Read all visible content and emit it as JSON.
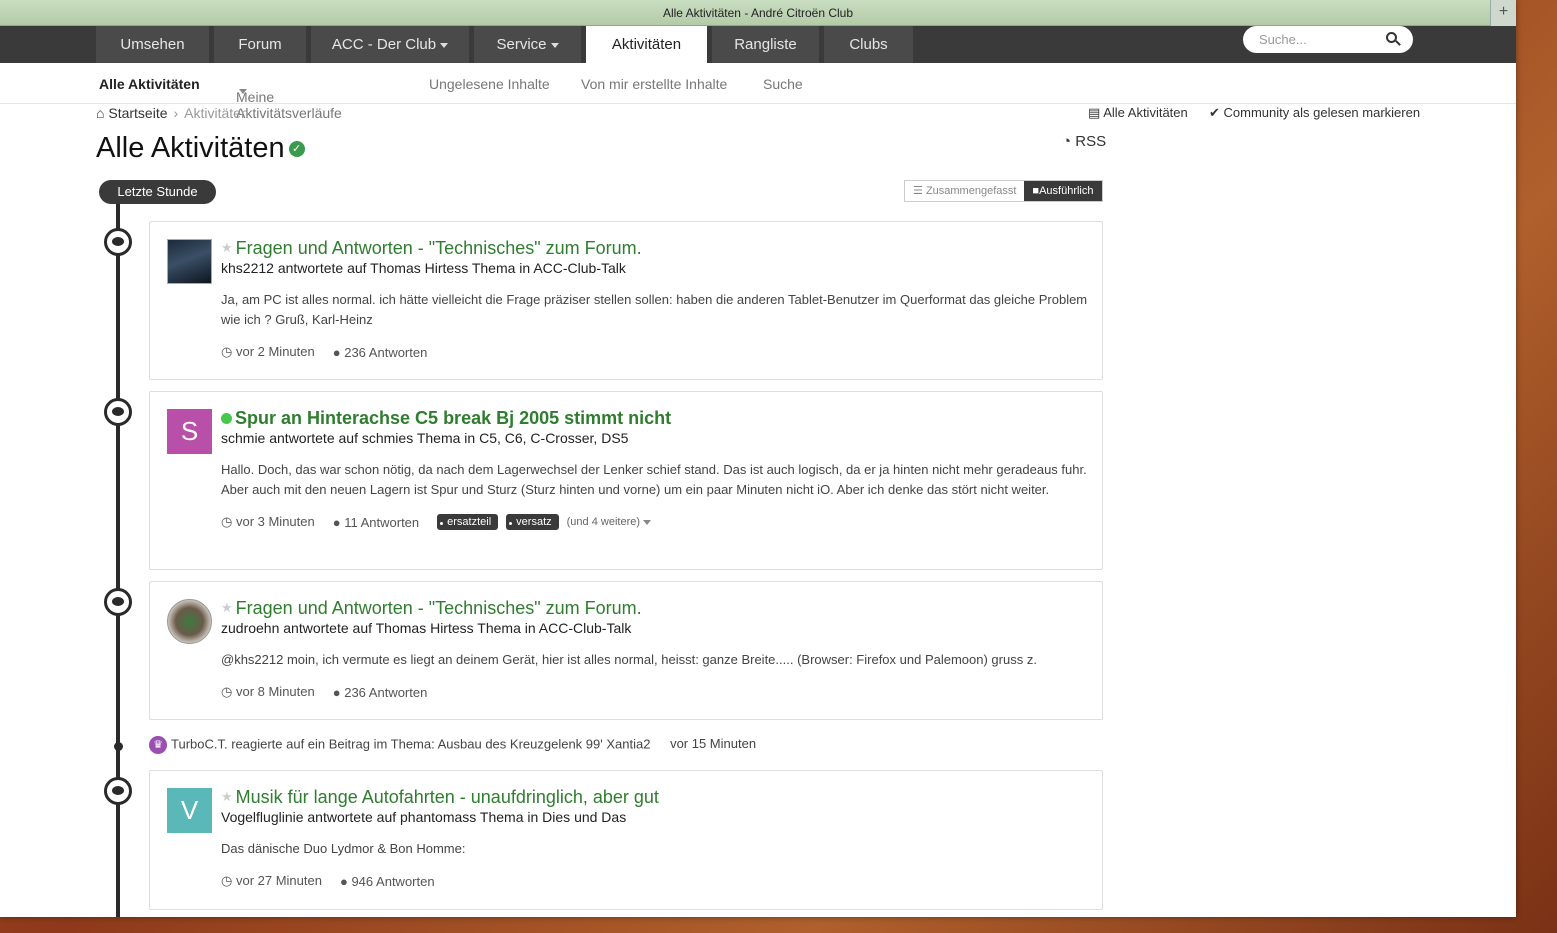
{
  "window": {
    "title": "Alle Aktivitäten - André Citroën Club"
  },
  "nav": {
    "items": [
      {
        "label": "Umsehen"
      },
      {
        "label": "Forum"
      },
      {
        "label": "ACC - Der Club"
      },
      {
        "label": "Service"
      },
      {
        "label": "Aktivitäten"
      },
      {
        "label": "Rangliste"
      },
      {
        "label": "Clubs"
      }
    ],
    "search_placeholder": "Suche..."
  },
  "subnav": {
    "items": [
      {
        "label": "Alle Aktivitäten"
      },
      {
        "label": "Meine Aktivitätsverläufe"
      },
      {
        "label": "Ungelesene Inhalte"
      },
      {
        "label": "Von mir erstellte Inhalte"
      },
      {
        "label": "Suche"
      }
    ]
  },
  "breadcrumb": {
    "home": "Startseite",
    "current": "Aktivitäten"
  },
  "top_actions": {
    "all_activity": "Alle Aktivitäten",
    "mark_read": "Community als gelesen markieren"
  },
  "page": {
    "title": "Alle Aktivitäten",
    "rss": "RSS"
  },
  "filter": {
    "time_pill": "Letzte Stunde",
    "condensed": "Zusammengefasst",
    "expanded": "Ausführlich"
  },
  "cards": [
    {
      "title": "Fragen und Antworten - \"Technisches\" zum Forum.",
      "subtitle": "khs2212 antwortete auf Thomas Hirtess Thema in ACC-Club-Talk",
      "text": "Ja, am PC ist alles normal. ich hätte vielleicht die Frage präziser stellen sollen: haben die anderen Tablet-Benutzer im Querformat das gleiche Problem wie ich ? Gruß, Karl-Heinz",
      "time": "vor 2 Minuten",
      "replies": "236 Antworten"
    },
    {
      "title": "Spur an Hinterachse C5 break Bj 2005 stimmt nicht",
      "subtitle": "schmie antwortete auf schmies Thema in C5, C6, C-Crosser, DS5",
      "text": "Hallo. Doch, das war schon nötig, da nach dem Lagerwechsel der Lenker schief stand. Das ist auch logisch, da er ja hinten nicht mehr geradeaus fuhr. Aber auch mit den neuen Lagern ist Spur und Sturz (Sturz hinten und vorne) um ein paar Minuten nicht iO. Aber ich denke das stört nicht weiter.",
      "time": "vor 3 Minuten",
      "replies": "11 Antworten",
      "avatar_letter": "S",
      "tags": [
        "ersatzteil",
        "versatz"
      ],
      "more_tags": "(und 4 weitere)"
    },
    {
      "title": "Fragen und Antworten - \"Technisches\" zum Forum.",
      "subtitle": "zudroehn antwortete auf Thomas Hirtess Thema in ACC-Club-Talk",
      "text": "@khs2212 moin, ich vermute es liegt an deinem Gerät, hier ist alles normal, heisst: ganze Breite..... (Browser: Firefox und Palemoon) gruss z.",
      "time": "vor 8 Minuten",
      "replies": "236 Antworten"
    },
    {
      "title": "Musik für lange Autofahrten - unaufdringlich, aber gut",
      "subtitle": "Vogelfluglinie antwortete auf phantomass Thema in Dies und Das",
      "text": "Das dänische Duo Lydmor & Bon Homme:",
      "time": "vor 27 Minuten",
      "replies": "946 Antworten",
      "avatar_letter": "V"
    }
  ],
  "reaction": {
    "text": "TurboC.T. reagierte auf ein Beitrag im Thema: Ausbau des Kreuzgelenk 99' Xantia2",
    "time": "vor 15 Minuten"
  },
  "colors": {
    "accent_green": "#2f7d2f",
    "nav_dark": "#3a3a3a",
    "avatar_s": "#b84fa8",
    "avatar_v": "#5bb8b8"
  }
}
